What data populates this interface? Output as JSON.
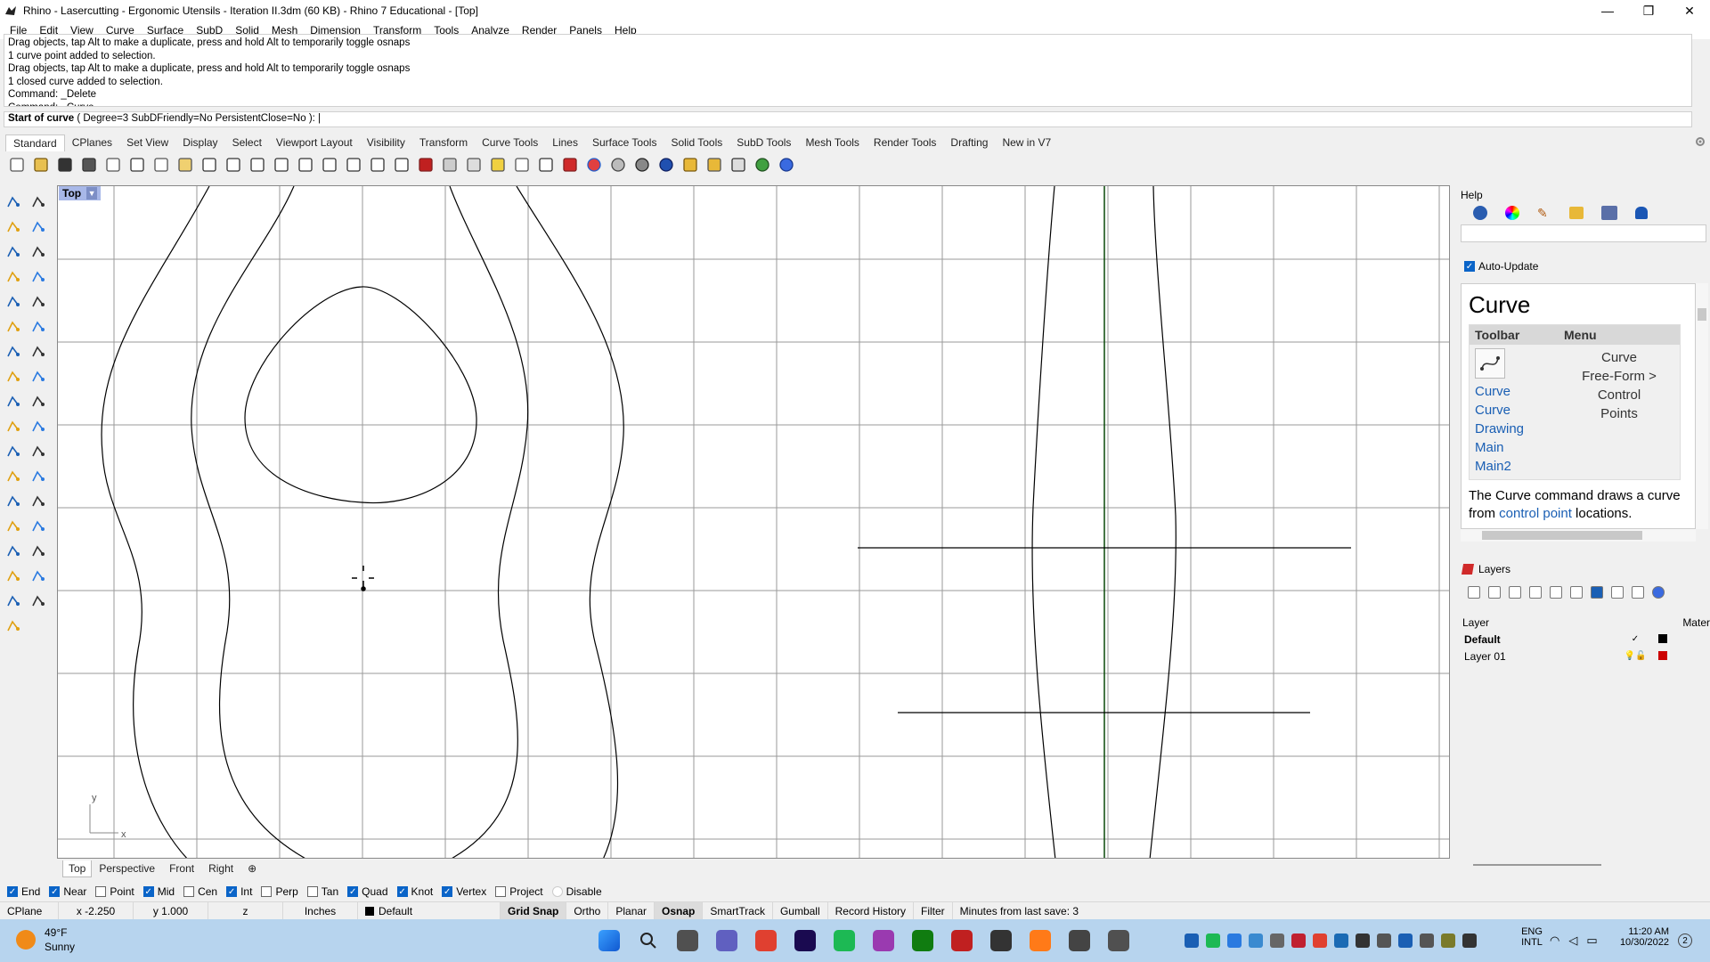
{
  "window": {
    "title": "Rhino - Lasercutting - Ergonomic Utensils - Iteration II.3dm (60 KB) - Rhino 7 Educational - [Top]",
    "minimize": "—",
    "maximize": "❐",
    "close": "✕"
  },
  "menu": [
    "File",
    "Edit",
    "View",
    "Curve",
    "Surface",
    "SubD",
    "Solid",
    "Mesh",
    "Dimension",
    "Transform",
    "Tools",
    "Analyze",
    "Render",
    "Panels",
    "Help"
  ],
  "command_history": [
    "Drag objects, tap Alt to make a duplicate, press and hold Alt to temporarily toggle osnaps",
    "1 curve point added to selection.",
    "Drag objects, tap Alt to make a duplicate, press and hold Alt to temporarily toggle osnaps",
    "1 closed curve added to selection.",
    "Command: _Delete",
    "Command: _Curve"
  ],
  "command_prompt": {
    "label": "Start of curve",
    "options": "( Degree=3  SubDFriendly=No  PersistentClose=No ):"
  },
  "toolbar_tabs": [
    "Standard",
    "CPlanes",
    "Set View",
    "Display",
    "Select",
    "Viewport Layout",
    "Visibility",
    "Transform",
    "Curve Tools",
    "Lines",
    "Surface Tools",
    "Solid Tools",
    "SubD Tools",
    "Mesh Tools",
    "Render Tools",
    "Drafting",
    "New in V7"
  ],
  "active_toolbar_tab": "Standard",
  "viewport": {
    "name": "Top",
    "axis_x": "x",
    "axis_y": "y"
  },
  "viewport_tabs": [
    "Top",
    "Perspective",
    "Front",
    "Right"
  ],
  "active_viewport_tab": "Top",
  "osnaps": [
    {
      "label": "End",
      "checked": true
    },
    {
      "label": "Near",
      "checked": true
    },
    {
      "label": "Point",
      "checked": false
    },
    {
      "label": "Mid",
      "checked": true
    },
    {
      "label": "Cen",
      "checked": false
    },
    {
      "label": "Int",
      "checked": true
    },
    {
      "label": "Perp",
      "checked": false
    },
    {
      "label": "Tan",
      "checked": false
    },
    {
      "label": "Quad",
      "checked": true
    },
    {
      "label": "Knot",
      "checked": true
    },
    {
      "label": "Vertex",
      "checked": true
    },
    {
      "label": "Project",
      "checked": false
    },
    {
      "label": "Disable",
      "checked": false
    }
  ],
  "status": {
    "cplane": "CPlane",
    "x": "x -2.250",
    "y": "y 1.000",
    "z": "z",
    "units": "Inches",
    "layer": "Default",
    "grid_snap": "Grid Snap",
    "ortho": "Ortho",
    "planar": "Planar",
    "osnap": "Osnap",
    "smarttrack": "SmartTrack",
    "gumball": "Gumball",
    "record_history": "Record History",
    "filter": "Filter",
    "minutes": "Minutes from last save: 3"
  },
  "help_panel": {
    "title": "Help",
    "auto_update": "Auto-Update",
    "heading": "Curve",
    "col_toolbar": "Toolbar",
    "col_menu": "Menu",
    "toolbar_links": [
      "Curve",
      "Curve Drawing",
      "Main",
      "Main2"
    ],
    "menu_path": [
      "Curve",
      "Free-Form >",
      "Control",
      "Points"
    ],
    "description_prefix": "The Curve command draws a curve from ",
    "description_link": "control point",
    "description_suffix": " locations."
  },
  "layers_panel": {
    "title": "Layers",
    "col_layer": "Layer",
    "col_material": "Mater",
    "rows": [
      {
        "name": "Default",
        "current": true,
        "color": "#000000"
      },
      {
        "name": "Layer 01",
        "current": false,
        "color": "#cc0000"
      }
    ]
  },
  "taskbar": {
    "weather_temp": "49°F",
    "weather_desc": "Sunny",
    "lang1": "ENG",
    "lang2": "INTL",
    "time": "11:20 AM",
    "date": "10/30/2022",
    "notif": "2"
  },
  "colors": {
    "accent": "#0a64c8",
    "viewport_label": "#a8b8e8",
    "taskbar": "#b7d4ee",
    "link": "#1a5fb4"
  }
}
